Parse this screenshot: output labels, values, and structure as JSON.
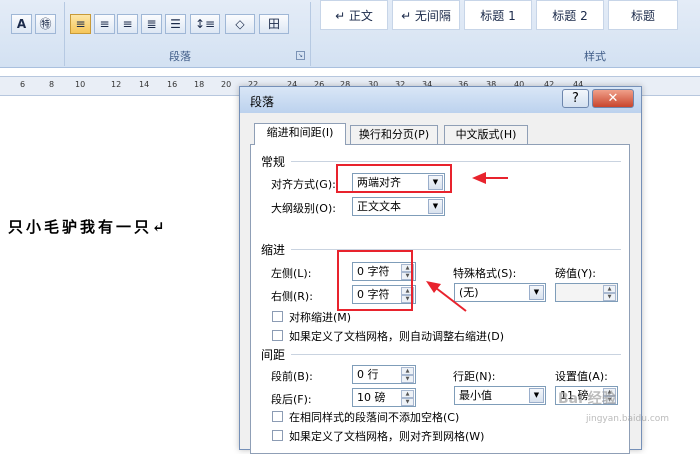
{
  "ribbon": {
    "groups": {
      "paragraph": "段落",
      "styles": "样式"
    },
    "buttons": {
      "text_effect": "A",
      "enclose_char": "㊕",
      "line_spacing": "↕≡",
      "shading": "◇",
      "borders": "田"
    },
    "styles": [
      "↵ 正文",
      "↵ 无间隔",
      "标题 1",
      "标题 2",
      "标题"
    ]
  },
  "ruler": {
    "marks": [
      "6",
      "8",
      "10",
      "12",
      "14",
      "16",
      "18",
      "20",
      "22",
      "24",
      "26",
      "28",
      "30",
      "32",
      "34",
      "36",
      "38",
      "40",
      "42",
      "44"
    ]
  },
  "document": {
    "text": "只小毛驴我有一只↵"
  },
  "dialog": {
    "title": "段落",
    "help": "?",
    "close": "✕",
    "tabs": [
      "缩进和间距(I)",
      "换行和分页(P)",
      "中文版式(H)"
    ],
    "general": {
      "heading": "常规",
      "alignment_label": "对齐方式(G):",
      "alignment_value": "两端对齐",
      "outline_label": "大纲级别(O):",
      "outline_value": "正文文本"
    },
    "indent": {
      "heading": "缩进",
      "left_label": "左侧(L):",
      "left_value": "0 字符",
      "right_label": "右侧(R):",
      "right_value": "0 字符",
      "special_label": "特殊格式(S):",
      "special_value": "(无)",
      "by_label": "磅值(Y):",
      "by_value": "",
      "mirror_label": "对称缩进(M)",
      "auto_adjust_label": "如果定义了文档网格，则自动调整右缩进(D)"
    },
    "spacing": {
      "heading": "间距",
      "before_label": "段前(B):",
      "before_value": "0 行",
      "after_label": "段后(F):",
      "after_value": "10 磅",
      "line_label": "行距(N):",
      "line_value": "最小值",
      "at_label": "设置值(A):",
      "at_value": "11 磅",
      "no_space_label": "在相同样式的段落间不添加空格(C)",
      "snap_grid_label": "如果定义了文档网格，则对齐到网格(W)"
    }
  },
  "watermark": {
    "text": "Bai 经验",
    "url": "jingyan.baidu.com"
  },
  "colors": {
    "annotation": "#e8232d",
    "ribbon": "#d3e1f2",
    "accent": "#f6c65a"
  }
}
